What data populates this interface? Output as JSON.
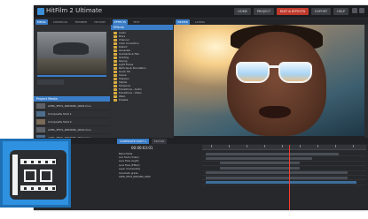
{
  "app": {
    "title": "HitFilm 2 Ultimate",
    "modes": [
      {
        "label": "HOME",
        "active": false
      },
      {
        "label": "PROJECT",
        "active": false
      },
      {
        "label": "EDIT & EFFECTS",
        "active": true
      },
      {
        "label": "EXPORT",
        "active": false
      },
      {
        "label": "HELP",
        "active": false
      }
    ]
  },
  "media_panel": {
    "tabs": [
      "MEDIA",
      "CONTROLS",
      "TRIMMER",
      "HISTORY"
    ],
    "header": "Project Media",
    "items": [
      {
        "name": "AVML_EFCS_DROSMA_0009.mov"
      },
      {
        "name": "Composite Shot 1"
      },
      {
        "name": "Composite Shot 2"
      },
      {
        "name": "AVML_EFCS_DROSMA_0010.mov"
      },
      {
        "name": "AVML_EFCS_DROSMA_0011.mov"
      },
      {
        "name": "AVML_EFCS_DROSMA_0012.mov"
      }
    ]
  },
  "effects_panel": {
    "tabs": [
      "EFFECTS",
      "TEXT"
    ],
    "header": "Effects",
    "items": [
      "Audio",
      "Blurs",
      "Channel",
      "Color Correction",
      "Distort",
      "Generate",
      "Gradients & Fills",
      "Grading",
      "Keying",
      "Light Flares",
      "Particles & Simulation",
      "Quick 3D",
      "Scene",
      "Sharpen",
      "Stylize",
      "Temporal",
      "Transitions - Audio",
      "Transitions - Video",
      "Warp",
      "Presets"
    ]
  },
  "viewer": {
    "tabs": [
      "VIEWER",
      "LAYERS"
    ]
  },
  "timeline": {
    "tabs": [
      "COMPOSITE SHOT 1",
      "EDITOR"
    ],
    "timecode": "00:00:03:01",
    "tracks": [
      "Blend Mode",
      "Aux Track (Video)",
      "Lens Flare (Light)",
      "Lens Flare (Effect)",
      "Layer (Composite)",
      "Cinematic grade",
      "AVML_EFCS_DROSMA_0009"
    ]
  },
  "badge": {
    "icon": "film-strip-icon",
    "color": "#2f91e0"
  }
}
